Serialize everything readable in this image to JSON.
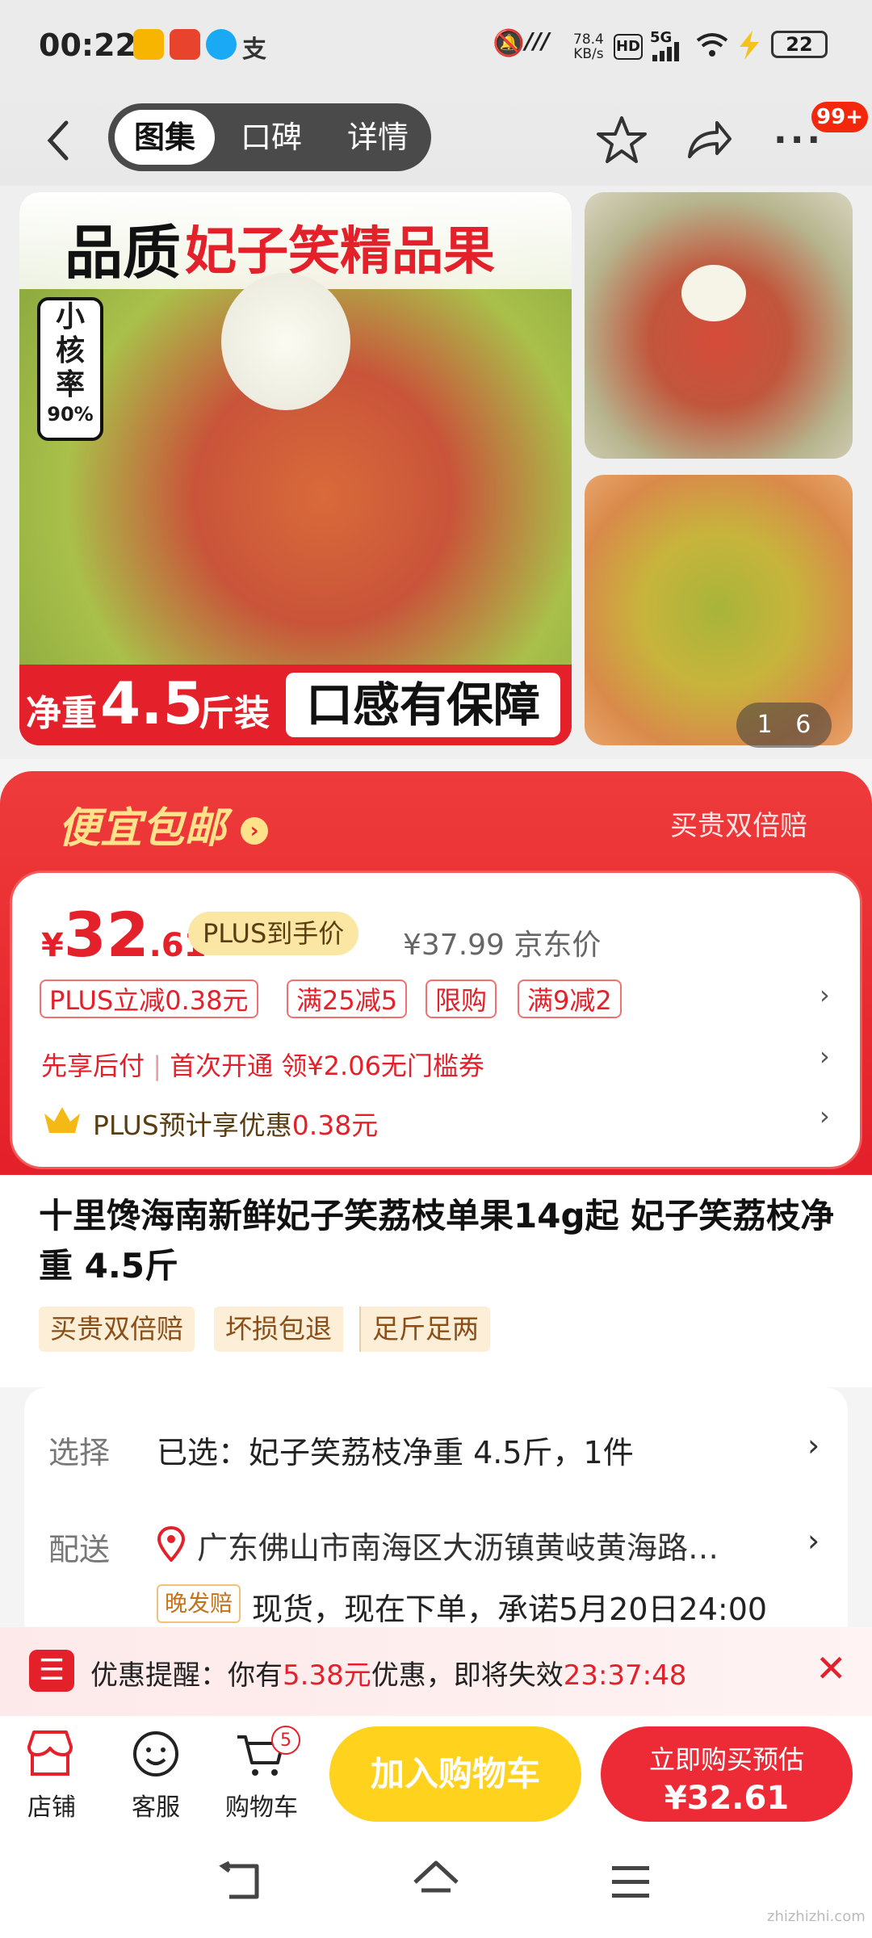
{
  "status_bar": {
    "time": "00:22",
    "net_speed_value": "78.4",
    "net_speed_unit": "KB/s",
    "hd": "HD",
    "signal": "5G",
    "battery": "22"
  },
  "top_nav": {
    "tabs": [
      "图集",
      "口碑",
      "详情"
    ],
    "active_tab": 0,
    "badge": "99+"
  },
  "gallery": {
    "main_image_text": {
      "headline_black": "品质",
      "headline_red": "妃子笑精品果",
      "side_label": [
        "小",
        "核",
        "率",
        "90%"
      ],
      "bottom_left_a": "净重",
      "bottom_left_b": "4.5",
      "bottom_left_c": "斤装",
      "bottom_right": "口感有保障"
    },
    "counter_current": "1",
    "counter_total": "6"
  },
  "promo": {
    "title": "便宜包邮",
    "right_text": "买贵双倍赔"
  },
  "price": {
    "currency": "¥",
    "integer": "32",
    "decimal": ".61",
    "plus_badge": "PLUS到手价",
    "original": "¥37.99",
    "original_label": "京东价",
    "tags": [
      "PLUS立减0.38元",
      "满25减5",
      "限购",
      "满9减2"
    ],
    "payment_line_a": "先享后付",
    "payment_line_b": "首次开通 领¥2.06无门槛券",
    "plus_line_prefix": "PLUS预计享优惠",
    "plus_line_amount": "0.38元"
  },
  "product": {
    "title": "十里馋海南新鲜妃子笑荔枝单果14g起 妃子笑荔枝净重 4.5斤",
    "guarantees": [
      "买贵双倍赔",
      "坏损包退",
      "足斤足两"
    ]
  },
  "options": {
    "select_label": "选择",
    "select_value": "已选：妃子笑荔枝净重 4.5斤，1件",
    "ship_label": "配送",
    "ship_address": "广东佛山市南海区大沥镇黄岐黄海路…",
    "late_badge": "晚发赔",
    "ship_note": "现货，现在下单，承诺5月20日24:00"
  },
  "reminder": {
    "prefix": "优惠提醒：你有",
    "amount": "5.38元",
    "middle": "优惠，即将失效",
    "countdown": "23:37:48"
  },
  "bottom_bar": {
    "shop": "店铺",
    "service": "客服",
    "cart": "购物车",
    "cart_count": "5",
    "add_to_cart": "加入购物车",
    "buy_now_line1": "立即购买预估",
    "buy_now_line2": "¥32.61"
  },
  "watermark": "zhizhizhi.com",
  "colors": {
    "brand_red": "#e4202a",
    "promo_gold": "#ffe28a",
    "cart_yellow": "#ffd21e"
  }
}
